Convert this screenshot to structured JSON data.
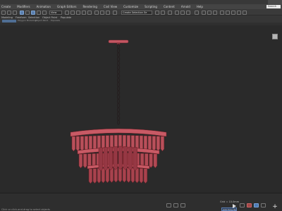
{
  "menu": {
    "items": [
      "Create",
      "Modifiers",
      "Animation",
      "Graph Editors",
      "Rendering",
      "Civil View",
      "Customize",
      "Scripting",
      "Content",
      "Arnold",
      "Help"
    ],
    "search_label": "Search"
  },
  "toolbar": {
    "view_dropdown": "View",
    "selection_set_dropdown": "Create Selection Se"
  },
  "ribbon": {
    "tabs": [
      "Modeling",
      "Freeform",
      "Selection",
      "Object Paint",
      "Populate"
    ],
    "subtabs": [
      "Polygon Modeling",
      "Object Paint",
      "Populate"
    ]
  },
  "viewport": {
    "model": "chandelier",
    "model_color": "#c0505a"
  },
  "status": {
    "left_text": "Click or click-and-drag to select objects",
    "coords": "Grid = 10.0mm",
    "add_time_tag": "Add Time Tag"
  }
}
